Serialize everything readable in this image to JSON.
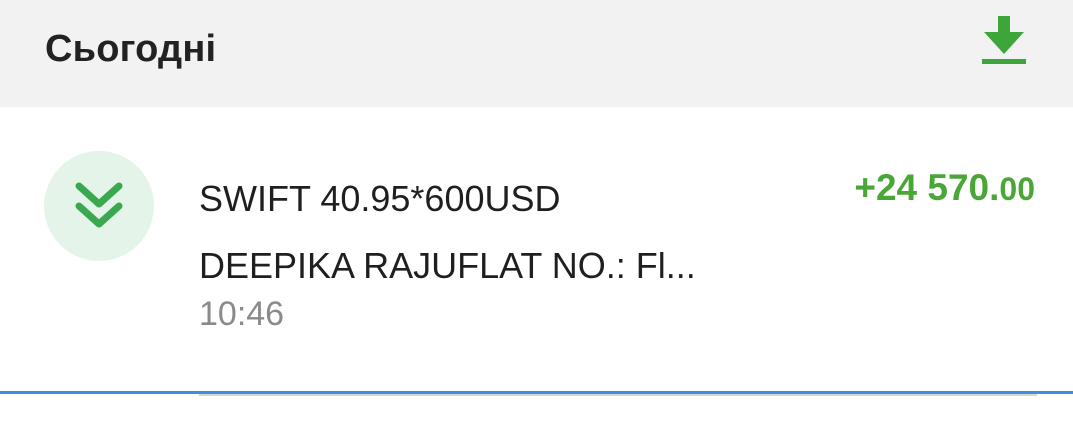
{
  "header": {
    "title": "Сьогодні",
    "download_icon": "download-icon",
    "accent_color": "#3da53a"
  },
  "transaction": {
    "direction_icon": "double-chevron-down-icon",
    "description_line1": "SWIFT 40.95*600USD",
    "description_line2": "DEEPIKA RAJUFLAT NO.: Fl...",
    "time": "10:46",
    "amount_main": "+24 570.",
    "amount_cents": "00",
    "amount_color": "#4aa637"
  }
}
